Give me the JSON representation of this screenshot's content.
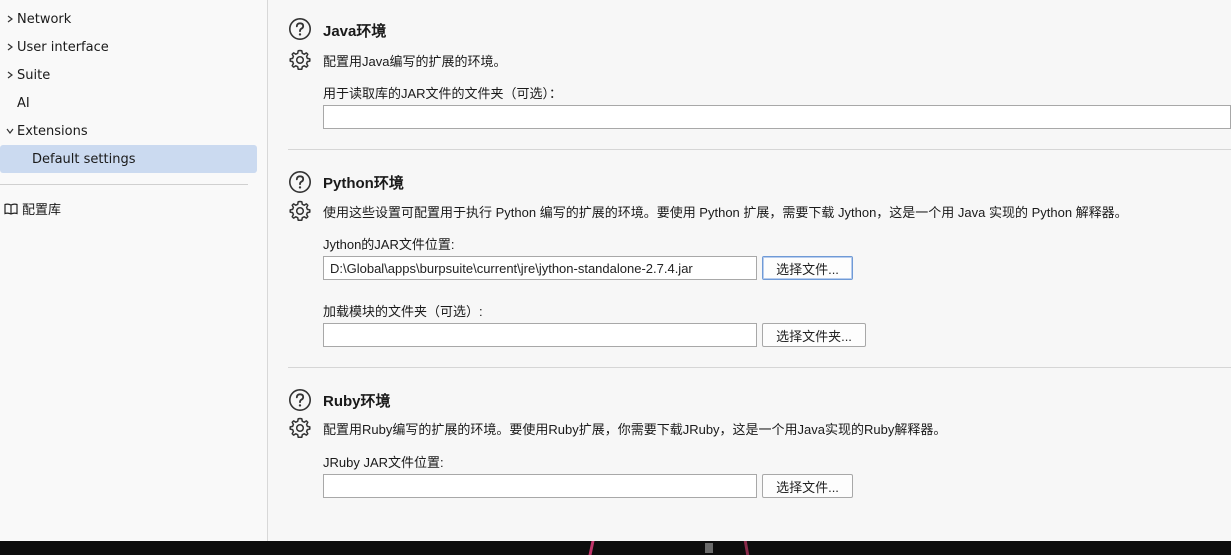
{
  "sidebar": {
    "items": [
      {
        "label": "Network",
        "expandable": true,
        "expanded": false
      },
      {
        "label": "User interface",
        "expandable": true,
        "expanded": false
      },
      {
        "label": "Suite",
        "expandable": true,
        "expanded": false
      },
      {
        "label": "AI",
        "expandable": false
      },
      {
        "label": "Extensions",
        "expandable": true,
        "expanded": true
      },
      {
        "label": "Default settings",
        "selected": true
      }
    ],
    "config_library": "配置库"
  },
  "sections": {
    "java": {
      "title": "Java环境",
      "description": "配置用Java编写的扩展的环境。",
      "folder_label": "用于读取库的JAR文件的文件夹（可选）：",
      "folder_value": ""
    },
    "python": {
      "title": "Python环境",
      "description": "使用这些设置可配置用于执行 Python 编写的扩展的环境。要使用 Python 扩展，需要下载 Jython，这是一个用 Java 实现的 Python 解释器。",
      "jar_label": "Jython的JAR文件位置:",
      "jar_value": "D:\\Global\\apps\\burpsuite\\current\\jre\\jython-standalone-2.7.4.jar",
      "select_file_button": "选择文件...",
      "modules_label": "加载模块的文件夹（可选）:",
      "modules_value": "",
      "select_folder_button": "选择文件夹..."
    },
    "ruby": {
      "title": "Ruby环境",
      "description": "配置用Ruby编写的扩展的环境。要使用Ruby扩展，你需要下载JRuby，这是一个用Java实现的Ruby解释器。",
      "jar_label": "JRuby JAR文件位置:",
      "jar_value": "",
      "select_file_button": "选择文件..."
    }
  },
  "colors": {
    "selected_bg": "#cbdaf0",
    "focus_border": "#6f9ad6"
  }
}
